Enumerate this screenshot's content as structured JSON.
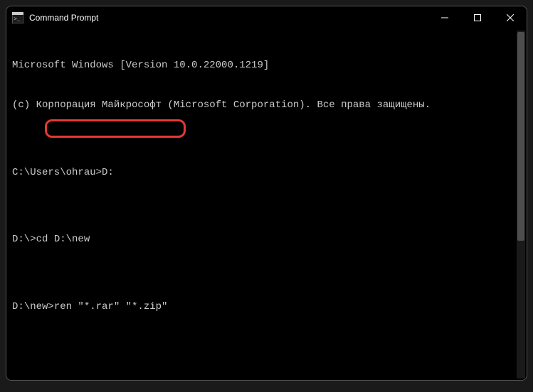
{
  "titlebar": {
    "title": "Command Prompt"
  },
  "terminal": {
    "line1": "Microsoft Windows [Version 10.0.22000.1219]",
    "line2": "(c) Корпорация Майкрософт (Microsoft Corporation). Все права защищены.",
    "blank1": "",
    "prompt1_path": "C:\\Users\\ohrau>",
    "prompt1_cmd": "D:",
    "blank2": "",
    "prompt2_path": "D:\\>",
    "prompt2_cmd": "cd D:\\new",
    "blank3": "",
    "prompt3_path": "D:\\new>",
    "prompt3_cmd": "ren \"*.rar\" \"*.zip\""
  }
}
